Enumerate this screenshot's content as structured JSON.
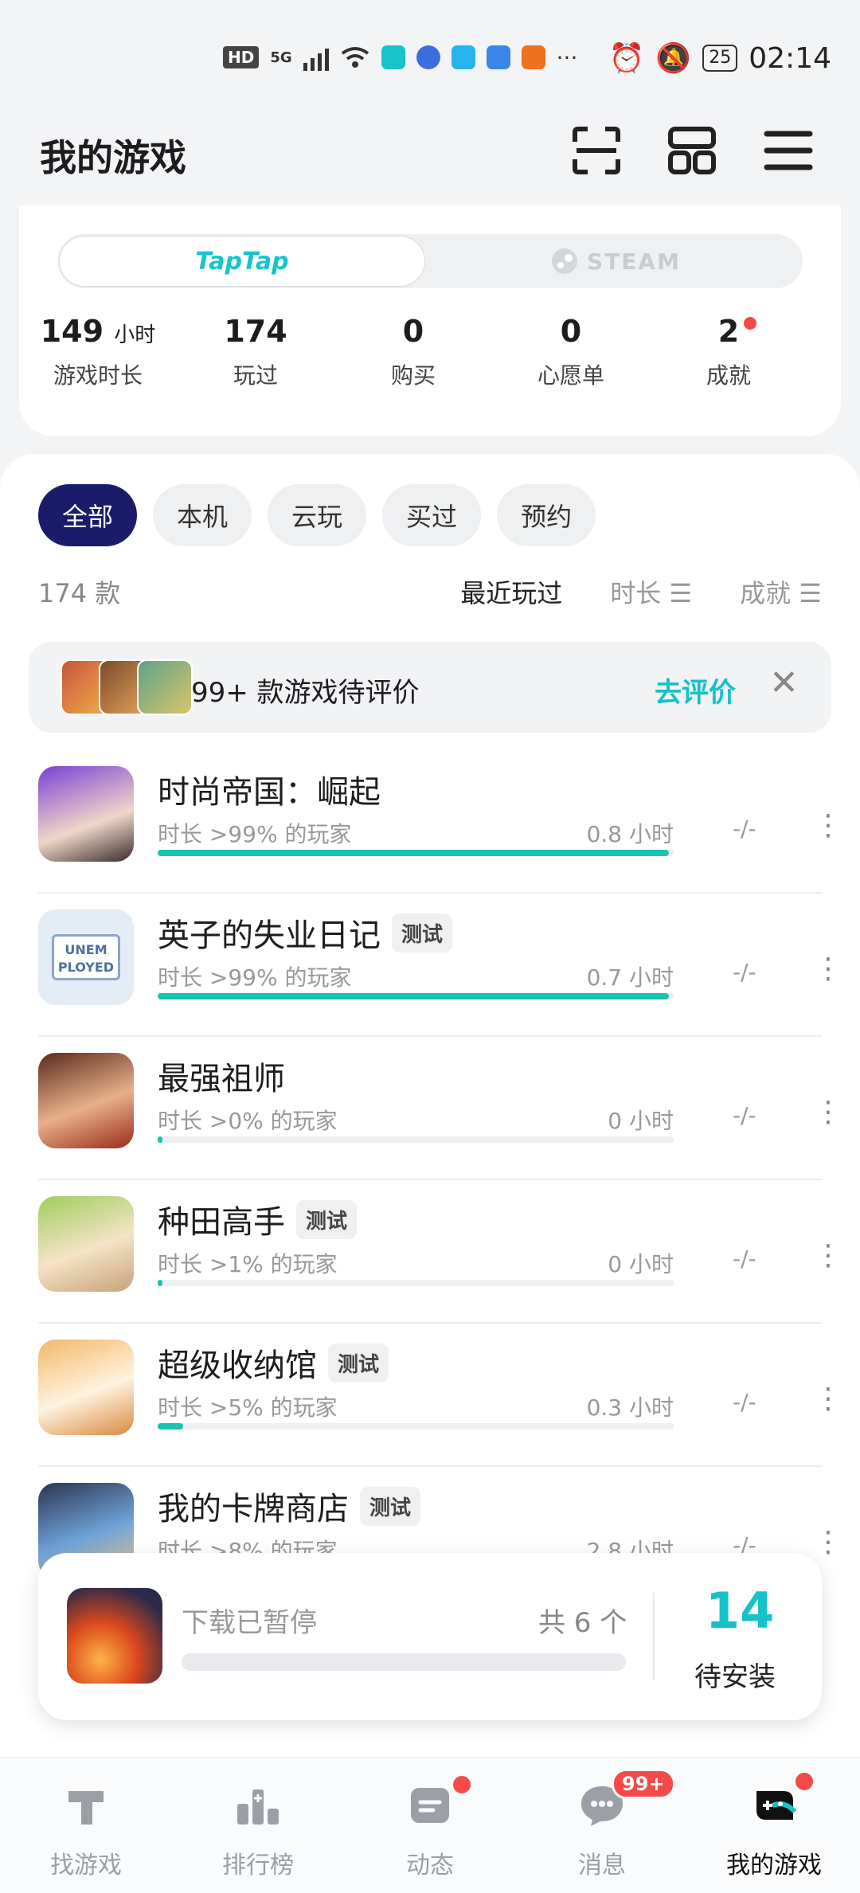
{
  "status": {
    "hd": "HD",
    "net": "5G",
    "time": "02:14",
    "battery": "25"
  },
  "header": {
    "title": "我的游戏"
  },
  "platform": {
    "taptap": "TapTap",
    "steam": "STEAM"
  },
  "stats": [
    {
      "num": "149",
      "unit": "小时",
      "label": "游戏时长"
    },
    {
      "num": "174",
      "unit": "",
      "label": "玩过"
    },
    {
      "num": "0",
      "unit": "",
      "label": "购买"
    },
    {
      "num": "0",
      "unit": "",
      "label": "心愿单"
    },
    {
      "num": "2",
      "unit": "",
      "label": "成就"
    }
  ],
  "filters": [
    "全部",
    "本机",
    "云玩",
    "买过",
    "预约"
  ],
  "list": {
    "count": "174 款",
    "sort_recent": "最近玩过",
    "sort_time": "时长 ☰",
    "sort_ach": "成就 ☰"
  },
  "banner": {
    "text": "99+ 款游戏待评价",
    "action": "去评价",
    "close": "✕"
  },
  "games": [
    {
      "name": "时尚帝国：崛起",
      "tag": "",
      "meta": "时长 >99% 的玩家",
      "hours": "0.8 小时",
      "percent": 99,
      "ach": "-/-"
    },
    {
      "name": "英子的失业日记",
      "tag": "测试",
      "meta": "时长 >99% 的玩家",
      "hours": "0.7 小时",
      "percent": 99,
      "ach": "-/-"
    },
    {
      "name": "最强祖师",
      "tag": "",
      "meta": "时长 >0% 的玩家",
      "hours": "0 小时",
      "percent": 0,
      "ach": "-/-"
    },
    {
      "name": "种田高手",
      "tag": "测试",
      "meta": "时长 >1% 的玩家",
      "hours": "0 小时",
      "percent": 1,
      "ach": "-/-"
    },
    {
      "name": "超级收纳馆",
      "tag": "测试",
      "meta": "时长 >5% 的玩家",
      "hours": "0.3 小时",
      "percent": 5,
      "ach": "-/-"
    },
    {
      "name": "我的卡牌商店",
      "tag": "测试",
      "meta": "时长 >8% 的玩家",
      "hours": "2.8 小时",
      "percent": 8,
      "ach": "-/-"
    }
  ],
  "download": {
    "status": "下载已暂停",
    "total": "共 6 个",
    "pending_count": "14",
    "pending_label": "待安装"
  },
  "nav": [
    {
      "label": "找游戏",
      "icon": "find-game-icon"
    },
    {
      "label": "排行榜",
      "icon": "ranking-icon"
    },
    {
      "label": "动态",
      "icon": "feed-icon"
    },
    {
      "label": "消息",
      "icon": "message-icon",
      "badge": "99+"
    },
    {
      "label": "我的游戏",
      "icon": "my-games-icon"
    }
  ]
}
